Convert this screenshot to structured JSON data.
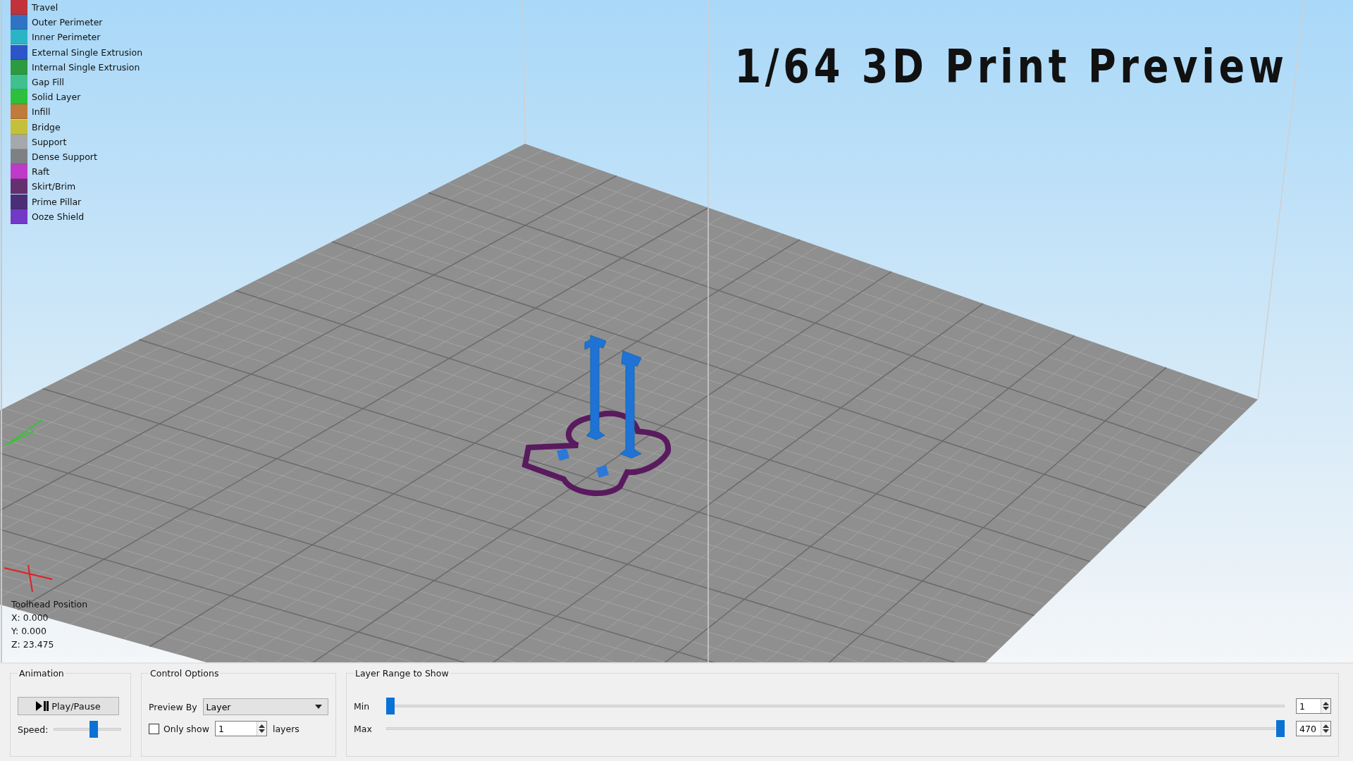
{
  "viewport": {
    "overlay_title": "1/64 3D Print Preview",
    "legend": [
      {
        "label": "Travel",
        "color": "#c0333a"
      },
      {
        "label": "Outer Perimeter",
        "color": "#2f73c4"
      },
      {
        "label": "Inner Perimeter",
        "color": "#2bb5c4"
      },
      {
        "label": "External Single Extrusion",
        "color": "#2b55c8"
      },
      {
        "label": "Internal Single Extrusion",
        "color": "#2c9a3e"
      },
      {
        "label": "Gap Fill",
        "color": "#3fc08c"
      },
      {
        "label": "Solid Layer",
        "color": "#2cc03c"
      },
      {
        "label": "Infill",
        "color": "#c07a3a"
      },
      {
        "label": "Bridge",
        "color": "#c4c03a"
      },
      {
        "label": "Support",
        "color": "#a6a8ab"
      },
      {
        "label": "Dense Support",
        "color": "#7e8184"
      },
      {
        "label": "Raft",
        "color": "#c03ac8"
      },
      {
        "label": "Skirt/Brim",
        "color": "#65306e"
      },
      {
        "label": "Prime Pillar",
        "color": "#4a2f78"
      },
      {
        "label": "Ooze Shield",
        "color": "#7438c8"
      }
    ],
    "toolhead": [
      "Toolhead Position",
      "X: 0.000",
      "Y: 0.000",
      "Z: 23.475"
    ]
  },
  "animation": {
    "title": "Animation",
    "play_button": "Play/Pause",
    "speed_label": "Speed:",
    "speed": {
      "level": 0.6
    }
  },
  "control_options": {
    "title": "Control Options",
    "preview_by_label": "Preview By",
    "preview_by": "Layer",
    "only_show": {
      "label": "Only show",
      "checked": false,
      "value": "1",
      "suffix": "layers"
    }
  },
  "layer_range": {
    "title": "Layer Range to Show",
    "sliders": [
      {
        "label": "Min",
        "level": 0,
        "value": "1"
      },
      {
        "label": "Max",
        "level": 1,
        "value": "470"
      }
    ]
  }
}
